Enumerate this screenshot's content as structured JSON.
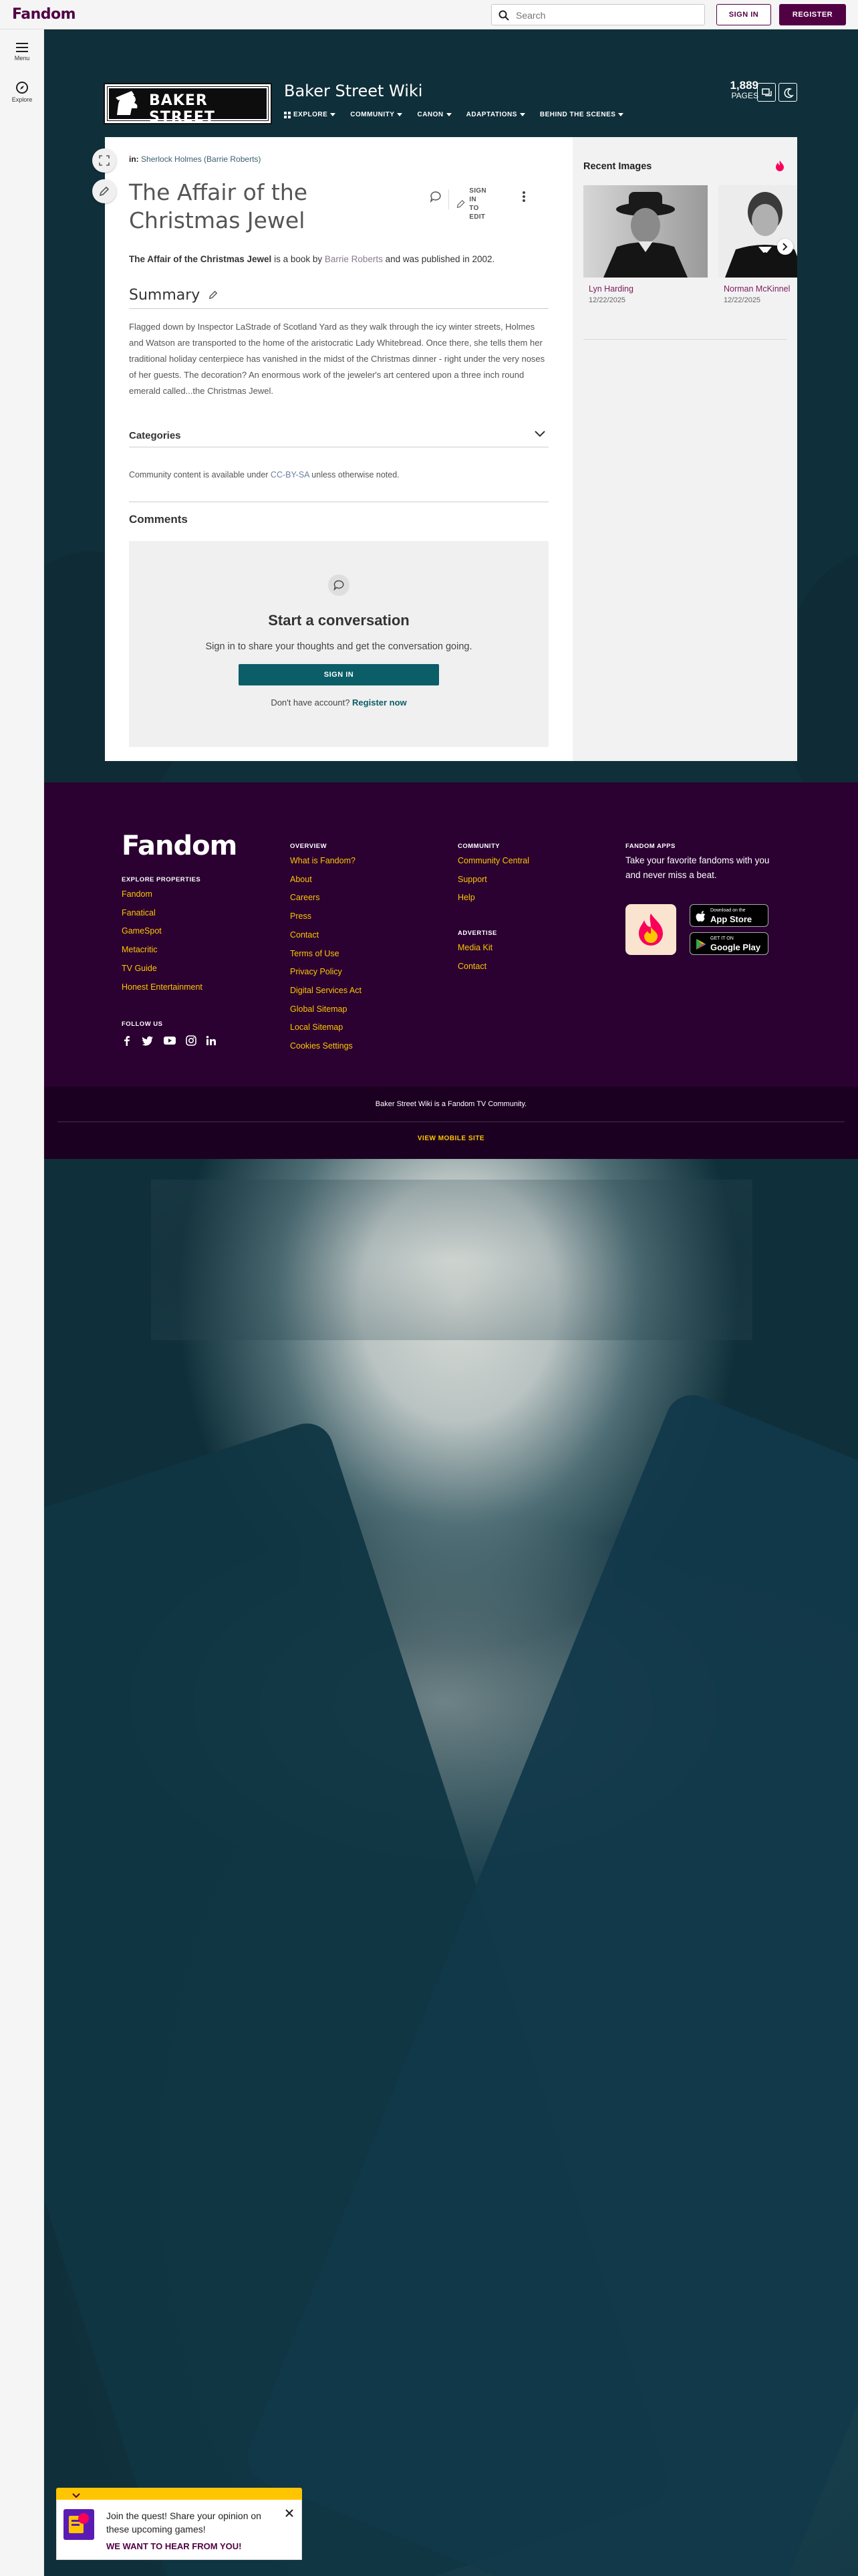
{
  "global_nav": {
    "logo": "Fandom",
    "search_placeholder": "Search",
    "sign_in": "SIGN IN",
    "register": "REGISTER"
  },
  "left_rail": {
    "menu": "Menu",
    "explore": "Explore"
  },
  "community": {
    "logo_text": "BAKER STREET",
    "wiki_name": "Baker Street Wiki",
    "nav": [
      {
        "label": "EXPLORE"
      },
      {
        "label": "COMMUNITY"
      },
      {
        "label": "CANON"
      },
      {
        "label": "ADAPTATIONS"
      },
      {
        "label": "BEHIND THE SCENES"
      }
    ],
    "pages_count": "1,889",
    "pages_label": "PAGES"
  },
  "article": {
    "breadcrumb_in": "in:",
    "breadcrumb_link": "Sherlock Holmes (Barrie Roberts)",
    "title": "The Affair of the Christmas Jewel",
    "sign_in_to_edit_line1": "SIGN IN",
    "sign_in_to_edit_line2": "TO EDIT",
    "intro_bold": "The Affair of the Christmas Jewel",
    "intro_pre": " is a book by ",
    "intro_link": "Barrie Roberts",
    "intro_post": " and was published in 2002.",
    "summary_heading": "Summary",
    "summary_text": "Flagged down by Inspector LaStrade of Scotland Yard as they walk through the icy winter streets, Holmes and Watson are transported to the home of the aristocratic Lady Whitebread. Once there, she tells them her traditional holiday centerpiece has vanished in the midst of the Christmas dinner - right under the very noses of her guests. The decoration? An enormous work of the jeweler's art centered upon a three inch round emerald called...the Christmas Jewel.",
    "categories": "Categories",
    "license_pre": "Community content is available under ",
    "license_link": "CC-BY-SA",
    "license_post": " unless otherwise noted.",
    "comments_heading": "Comments",
    "convo_title": "Start a conversation",
    "convo_sub": "Sign in to share your thoughts and get the conversation going.",
    "convo_signin": "SIGN IN",
    "convo_reg_pre": "Don't have account? ",
    "convo_reg_link": "Register now"
  },
  "recent_images": {
    "title": "Recent Images",
    "items": [
      {
        "name": "Lyn Harding",
        "date": "12/22/2025"
      },
      {
        "name": "Norman McKinnel",
        "date": "12/22/2025"
      }
    ]
  },
  "footer": {
    "logo": "Fandom",
    "explore_heading": "EXPLORE PROPERTIES",
    "explore": [
      "Fandom",
      "Fanatical",
      "GameSpot",
      "Metacritic",
      "TV Guide",
      "Honest Entertainment"
    ],
    "follow_heading": "FOLLOW US",
    "overview_heading": "OVERVIEW",
    "overview": [
      "What is Fandom?",
      "About",
      "Careers",
      "Press",
      "Contact",
      "Terms of Use",
      "Privacy Policy",
      "Digital Services Act",
      "Global Sitemap",
      "Local Sitemap",
      "Cookies Settings"
    ],
    "community_heading": "COMMUNITY",
    "community": [
      "Community Central",
      "Support",
      "Help"
    ],
    "advertise_heading": "ADVERTISE",
    "advertise": [
      "Media Kit",
      "Contact"
    ],
    "apps_heading": "FANDOM APPS",
    "apps_text": "Take your favorite fandoms with you and never miss a beat.",
    "app_store_small": "Download on the",
    "app_store_big": "App Store",
    "google_small": "GET IT ON",
    "google_big": "Google Play",
    "community_line": "Baker Street Wiki is a Fandom TV Community.",
    "mobile_site": "VIEW MOBILE SITE"
  },
  "quest": {
    "text": "Join the quest! Share your opinion on these upcoming games!",
    "cta": "WE WANT TO HEAR FROM YOU!"
  },
  "colors": {
    "brand": "#520044",
    "accent": "#fa005a",
    "footer_bg": "#2a0131",
    "footer_link": "#ffc500",
    "teal_button": "#0b5d68"
  }
}
